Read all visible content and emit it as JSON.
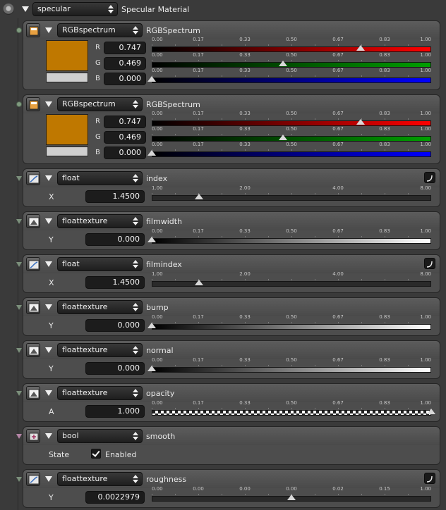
{
  "root": {
    "type_value": "specular",
    "title": "Specular Material"
  },
  "panels": [
    {
      "id": "p1",
      "type_value": "RGBspectrum",
      "title": "RGBSpectrum",
      "kind": "rgb",
      "color": "#bf7800",
      "channels": [
        {
          "label": "R",
          "value": "0.747",
          "frac": 0.747,
          "from": "#000000",
          "to": "#ff0000"
        },
        {
          "label": "G",
          "value": "0.469",
          "frac": 0.469,
          "from": "#000000",
          "to": "#00a000"
        },
        {
          "label": "B",
          "value": "0.000",
          "frac": 0.0,
          "from": "#000000",
          "to": "#0000ff"
        }
      ],
      "ticks": [
        "0.00",
        "0.17",
        "0.33",
        "0.50",
        "0.67",
        "0.83",
        "1.00"
      ]
    },
    {
      "id": "p2",
      "type_value": "RGBspectrum",
      "title": "RGBSpectrum",
      "kind": "rgb",
      "color": "#bf7800",
      "channels": [
        {
          "label": "R",
          "value": "0.747",
          "frac": 0.747,
          "from": "#000000",
          "to": "#ff0000"
        },
        {
          "label": "G",
          "value": "0.469",
          "frac": 0.469,
          "from": "#000000",
          "to": "#00a000"
        },
        {
          "label": "B",
          "value": "0.000",
          "frac": 0.0,
          "from": "#000000",
          "to": "#0000ff"
        }
      ],
      "ticks": [
        "0.00",
        "0.17",
        "0.33",
        "0.50",
        "0.67",
        "0.83",
        "1.00"
      ]
    },
    {
      "id": "p3",
      "type_value": "float",
      "title": "index",
      "kind": "float",
      "curve": true,
      "param_label": "X",
      "value": "1.4500",
      "frac": 0.17,
      "bar": "plain",
      "ticks": [
        "1.00",
        "2.00",
        "4.00",
        "8.00"
      ]
    },
    {
      "id": "p4",
      "type_value": "floattexture",
      "title": "filmwidth",
      "kind": "float",
      "param_label": "Y",
      "value": "0.000",
      "frac": 0.0,
      "bar": "gray",
      "ticks": [
        "0.00",
        "0.17",
        "0.33",
        "0.50",
        "0.67",
        "0.83",
        "1.00"
      ]
    },
    {
      "id": "p5",
      "type_value": "float",
      "title": "filmindex",
      "kind": "float",
      "curve": true,
      "param_label": "X",
      "value": "1.4500",
      "frac": 0.17,
      "bar": "plain",
      "ticks": [
        "1.00",
        "2.00",
        "4.00",
        "8.00"
      ]
    },
    {
      "id": "p6",
      "type_value": "floattexture",
      "title": "bump",
      "kind": "float",
      "param_label": "Y",
      "value": "0.000",
      "frac": 0.0,
      "bar": "gray",
      "ticks": [
        "0.00",
        "0.17",
        "0.33",
        "0.50",
        "0.67",
        "0.83",
        "1.00"
      ]
    },
    {
      "id": "p7",
      "type_value": "floattexture",
      "title": "normal",
      "kind": "float",
      "param_label": "Y",
      "value": "0.000",
      "frac": 0.0,
      "bar": "gray",
      "ticks": [
        "0.00",
        "0.17",
        "0.33",
        "0.50",
        "0.67",
        "0.83",
        "1.00"
      ]
    },
    {
      "id": "p8",
      "type_value": "floattexture",
      "title": "opacity",
      "kind": "float",
      "param_label": "A",
      "value": "1.000",
      "frac": 1.0,
      "bar": "checker",
      "ticks": [
        "0.00",
        "0.17",
        "0.33",
        "0.50",
        "0.67",
        "0.83",
        "1.00"
      ]
    },
    {
      "id": "p9",
      "type_value": "bool",
      "title": "smooth",
      "kind": "bool",
      "param_label": "State",
      "check_label": "Enabled",
      "checked": true
    },
    {
      "id": "p10",
      "type_value": "floattexture",
      "title": "roughness",
      "kind": "float",
      "curve": true,
      "param_label": "Y",
      "value": "0.0022979",
      "frac": 0.5,
      "bar": "plain",
      "ticks": [
        "0.00",
        "0.00",
        "0.00",
        "0.00",
        "0.02",
        "0.15",
        "1.00"
      ]
    }
  ]
}
